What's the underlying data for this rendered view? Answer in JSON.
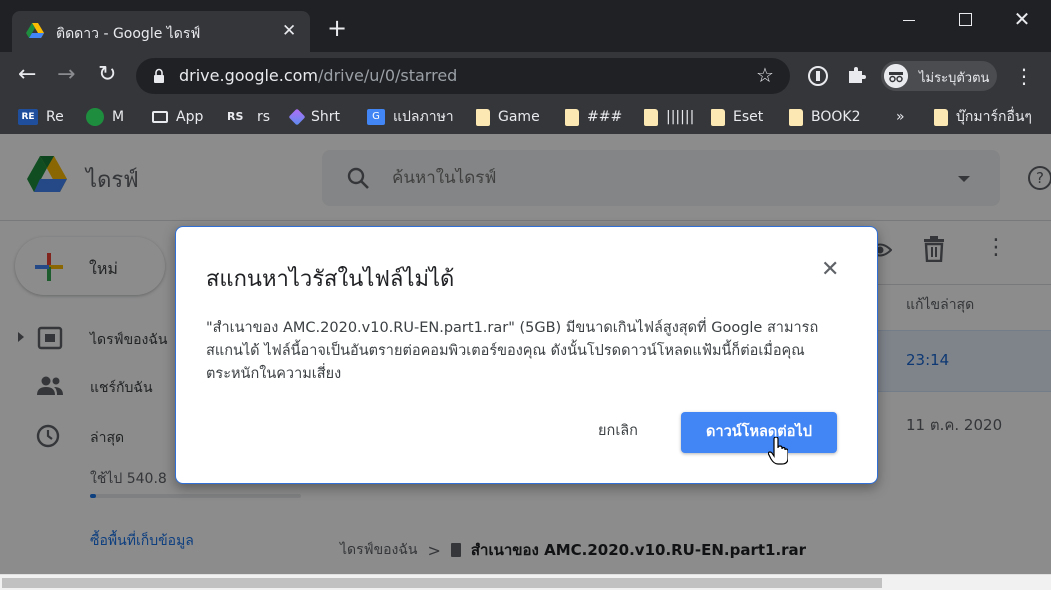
{
  "browser": {
    "tab_title": "ติดดาว - Google ไดรฟ์",
    "url_host": "drive.google.com",
    "url_path": "/drive/u/0/starred",
    "profile_label": "ไม่ระบุตัวตน"
  },
  "bookmarks": [
    {
      "label": "Re",
      "icon": "re-logo"
    },
    {
      "label": "M",
      "icon": "m-logo"
    },
    {
      "label": "App",
      "icon": "app-icon"
    },
    {
      "label": "rs",
      "icon": "rs-logo"
    },
    {
      "label": "Shrt",
      "icon": "shrt-icon"
    },
    {
      "label": "แปลภาษา",
      "icon": "translate-icon"
    },
    {
      "label": "Game",
      "icon": "folder-icon"
    },
    {
      "label": "###",
      "icon": "folder-icon"
    },
    {
      "label": "||||||",
      "icon": "folder-icon"
    },
    {
      "label": "Eset",
      "icon": "folder-icon"
    },
    {
      "label": "BOOK2",
      "icon": "folder-icon"
    },
    {
      "label": "»",
      "icon": ""
    },
    {
      "label": "บุ๊กมาร์กอื่นๆ",
      "icon": "folder-icon"
    }
  ],
  "drive": {
    "title": "ไดรฟ์",
    "search_placeholder": "ค้นหาในไดรฟ์",
    "new_label": "ใหม่",
    "nav": {
      "my_drive": "ไดรฟ์ของฉัน",
      "shared": "แชร์กับฉัน",
      "recent": "ล่าสุด"
    },
    "storage_text": "ใช้ไป 540.8",
    "storage_fraction": 0.03,
    "buy_storage": "ซื้อพื้นที่เก็บข้อมูล",
    "col_modified": "แก้ไขล่าสุด",
    "row1_time": "23:14",
    "row2_time": "11 ต.ค. 2020",
    "breadcrumb_root": "ไดรฟ์ของฉัน",
    "breadcrumb_sep": ">",
    "breadcrumb_file": "สำเนาของ AMC.2020.v10.RU-EN.part1.rar"
  },
  "dialog": {
    "title": "สแกนหาไวรัสในไฟล์ไม่ได้",
    "body": "\"สำเนาของ AMC.2020.v10.RU-EN.part1.rar\" (5GB) มีขนาดเกินไฟล์สูงสุดที่ Google สามารถสแกนได้ ไฟล์นี้อาจเป็นอันตรายต่อคอมพิวเตอร์ของคุณ ดังนั้นโปรดดาวน์โหลดแฟ้มนี้ก็ต่อเมื่อคุณตระหนักในความเสี่ยง",
    "cancel": "ยกเลิก",
    "download": "ดาวน์โหลดต่อไป"
  }
}
